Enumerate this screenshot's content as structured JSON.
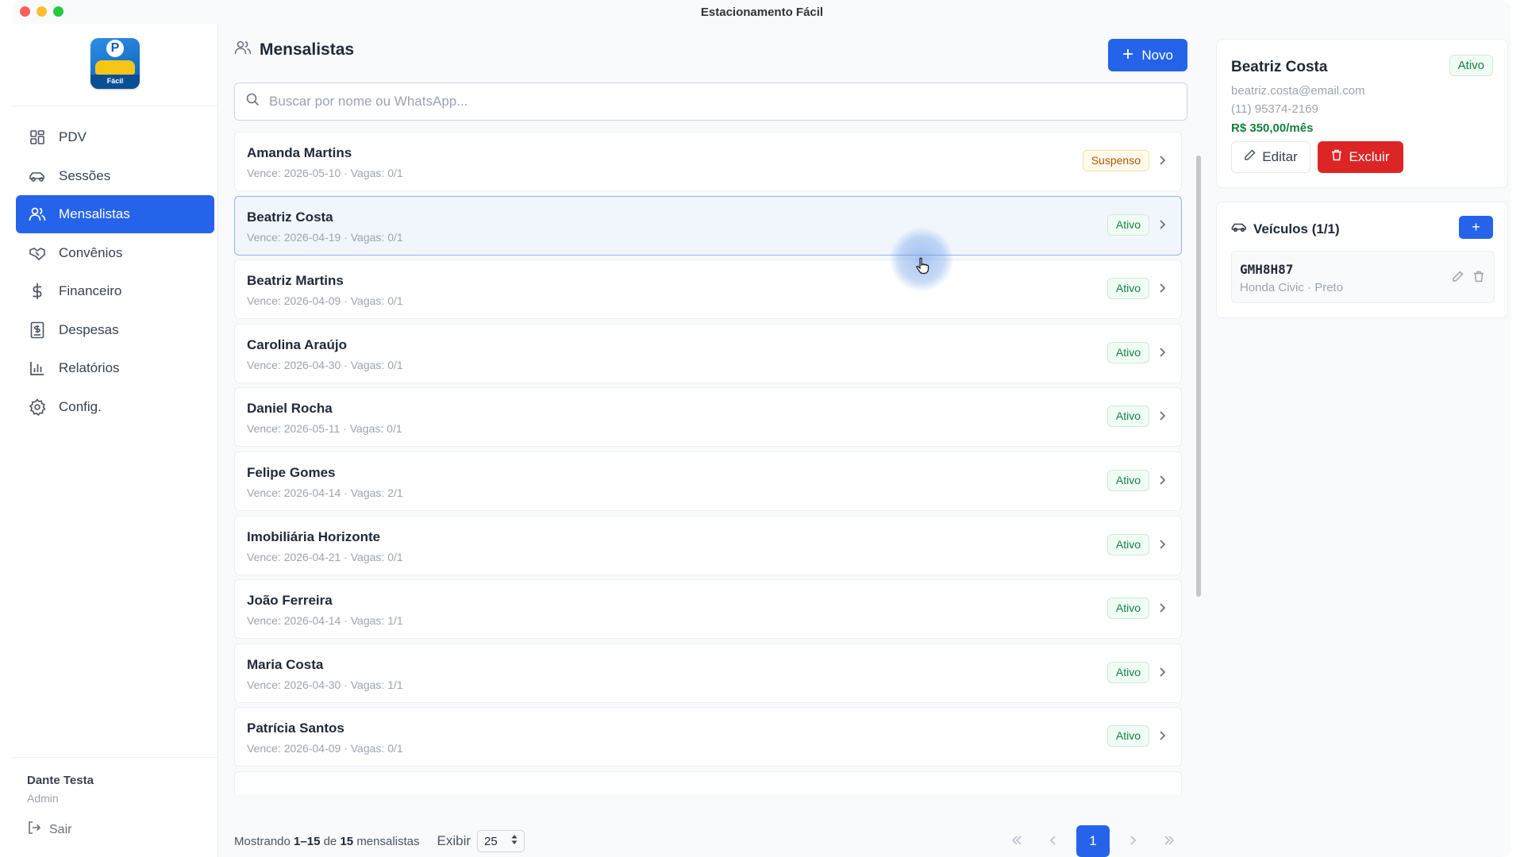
{
  "window": {
    "title": "Estacionamento Fácil"
  },
  "sidebar": {
    "logo_text": "Fácil",
    "items": [
      {
        "label": "PDV",
        "icon": "grid-icon"
      },
      {
        "label": "Sessões",
        "icon": "car-icon"
      },
      {
        "label": "Mensalistas",
        "icon": "users-icon",
        "active": true
      },
      {
        "label": "Convênios",
        "icon": "handshake-icon"
      },
      {
        "label": "Financeiro",
        "icon": "dollar-icon"
      },
      {
        "label": "Despesas",
        "icon": "receipt-icon"
      },
      {
        "label": "Relatórios",
        "icon": "bar-chart-icon"
      },
      {
        "label": "Config.",
        "icon": "gear-icon"
      }
    ],
    "user": {
      "name": "Dante Testa",
      "role": "Admin"
    },
    "logout_label": "Sair"
  },
  "main": {
    "title": "Mensalistas",
    "new_button": "Novo",
    "search_placeholder": "Buscar por nome ou WhatsApp...",
    "rows": [
      {
        "name": "Amanda Martins",
        "meta": "Vence: 2026-05-10 · Vagas: 0/1",
        "status": "Suspenso"
      },
      {
        "name": "Beatriz Costa",
        "meta": "Vence: 2026-04-19 · Vagas: 0/1",
        "status": "Ativo"
      },
      {
        "name": "Beatriz Martins",
        "meta": "Vence: 2026-04-09 · Vagas: 0/1",
        "status": "Ativo"
      },
      {
        "name": "Carolina Araújo",
        "meta": "Vence: 2026-04-30 · Vagas: 0/1",
        "status": "Ativo"
      },
      {
        "name": "Daniel Rocha",
        "meta": "Vence: 2026-05-11 · Vagas: 0/1",
        "status": "Ativo"
      },
      {
        "name": "Felipe Gomes",
        "meta": "Vence: 2026-04-14 · Vagas: 2/1",
        "status": "Ativo"
      },
      {
        "name": "Imobiliária Horizonte",
        "meta": "Vence: 2026-04-21 · Vagas: 0/1",
        "status": "Ativo"
      },
      {
        "name": "João Ferreira",
        "meta": "Vence: 2026-04-14 · Vagas: 1/1",
        "status": "Ativo"
      },
      {
        "name": "Maria Costa",
        "meta": "Vence: 2026-04-30 · Vagas: 1/1",
        "status": "Ativo"
      },
      {
        "name": "Patrícia Santos",
        "meta": "Vence: 2026-04-09 · Vagas: 0/1",
        "status": "Ativo"
      }
    ],
    "footer": {
      "showing_prefix": "Mostrando",
      "range": "1–15",
      "of": "de",
      "total": "15",
      "suffix": "mensalistas",
      "per_page_label": "Exibir",
      "per_page_value": "25",
      "current_page": "1"
    }
  },
  "detail": {
    "name": "Beatriz Costa",
    "status": "Ativo",
    "email": "beatriz.costa@email.com",
    "phone": "(11) 95374-2169",
    "price": "R$ 350,00/mês",
    "edit_button": "Editar",
    "delete_button": "Excluir"
  },
  "vehicles": {
    "title": "Veículos (1/1)",
    "add_button": "+",
    "items": [
      {
        "plate": "GMH8H87",
        "model": "Honda Civic · Preto"
      }
    ]
  },
  "colors": {
    "accent": "#2563eb",
    "success": "#15803d",
    "warning": "#b45309",
    "danger": "#dc2626"
  }
}
